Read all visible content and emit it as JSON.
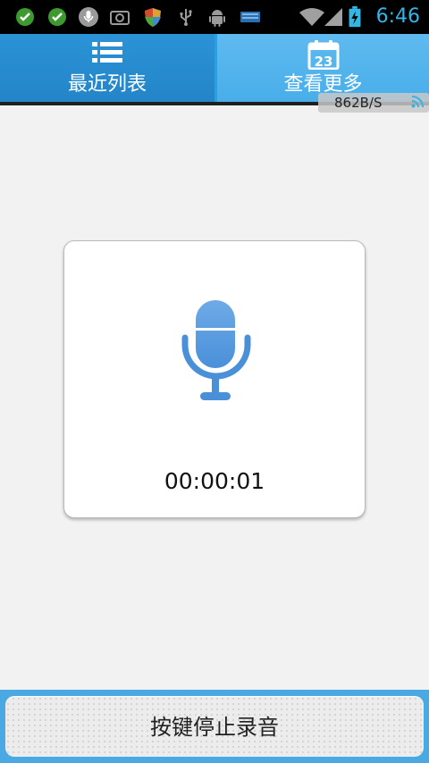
{
  "status_bar": {
    "time": "6:46",
    "icons": [
      "check-circle-icon",
      "check-circle-icon",
      "microphone-icon",
      "camera-icon",
      "shield-icon",
      "usb-icon",
      "android-icon",
      "storage-icon",
      "wifi-icon",
      "signal-icon",
      "battery-charging-icon"
    ],
    "accent": "#33b5e5"
  },
  "tabs": [
    {
      "label": "最近列表",
      "icon": "list-icon"
    },
    {
      "label": "查看更多",
      "icon": "calendar-icon",
      "icon_text": "23"
    }
  ],
  "speed_overlay": {
    "text": "862B/S"
  },
  "recorder": {
    "icon": "microphone-icon",
    "elapsed": "00:00:01",
    "mic_color": "#4a90d9"
  },
  "bottom_button": {
    "label": "按键停止录音"
  }
}
